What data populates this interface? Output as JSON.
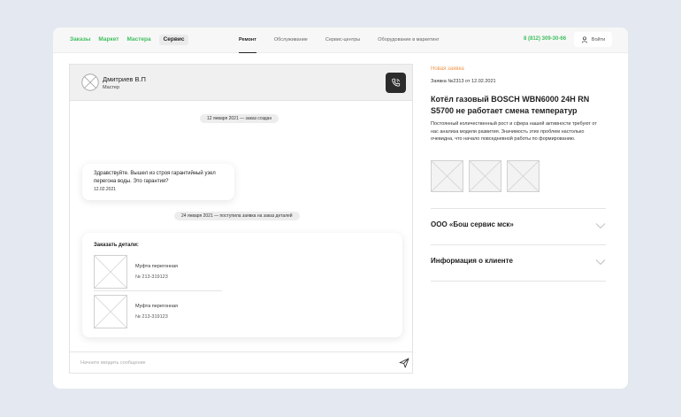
{
  "header": {
    "nav_left": [
      "Заказы",
      "Маркет",
      "Мастера"
    ],
    "nav_service": "Сервис",
    "tabs": [
      {
        "label": "Ремонт",
        "active": true
      },
      {
        "label": "Обслуживание",
        "active": false
      },
      {
        "label": "Сервис-центры",
        "active": false
      },
      {
        "label": "Оборудование в маркетинг",
        "active": false
      }
    ],
    "phone": "8 (812) 309-30-66",
    "login_label": "Войти"
  },
  "chat": {
    "contact_name": "Дмитриев В.П",
    "contact_role": "Мастер",
    "system_messages": [
      "12 января 2021 — заказ создан",
      "24 января 2021 — поступила заявка на заказ деталей"
    ],
    "message": {
      "text": "Здравствуйте. Вышел из строя гарантийный узел перегона воды. Это гарантия?",
      "date": "12.02.2021"
    },
    "order": {
      "title": "Заказать детали:",
      "parts": [
        {
          "name": "Муфта перегонная",
          "number": "№ 213-319123"
        },
        {
          "name": "Муфта перегонная",
          "number": "№ 213-319123"
        }
      ]
    },
    "input_placeholder": "Начните вводить сообщение"
  },
  "request": {
    "status": "Новая заявка",
    "id_line": "Заявка №2313 от 12.02.2021",
    "title": "Котёл газовый BOSCH WBN6000 24H RN S5700 не работает смена температур",
    "description": "Постоянный количественный рост и сфера нашей активности требуют от нас анализа модели развития. Значимость этих проблем настолько очевидна, что начало повседневной работы по формированию.",
    "accordion": [
      "ООО «Бош сервис мск»",
      "Информация о клиенте"
    ]
  },
  "colors": {
    "accent_green": "#3fbf5f",
    "status_orange": "#f0964c",
    "page_bg": "#e4e8f1"
  }
}
